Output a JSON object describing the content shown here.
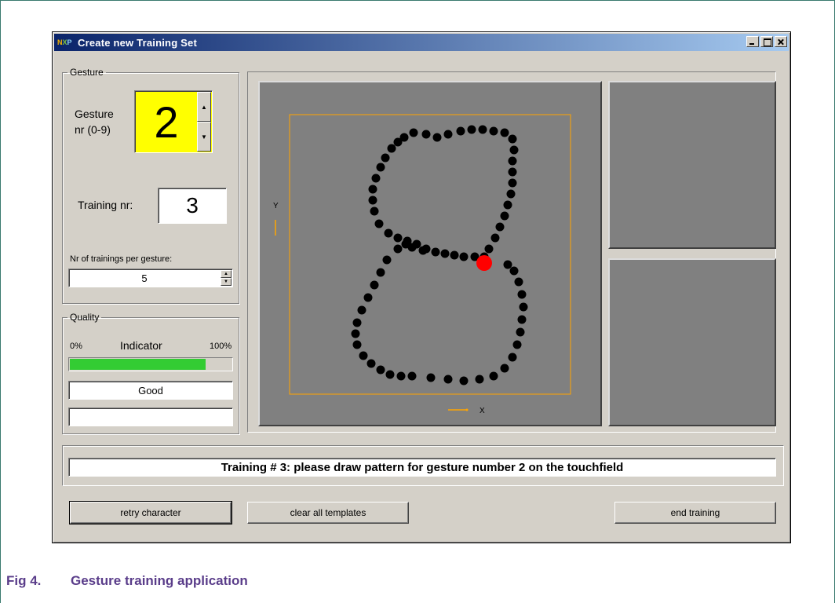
{
  "window": {
    "title": "Create new Training Set",
    "logo": {
      "n": "N",
      "x": "X",
      "p": "P"
    }
  },
  "gesture_group": {
    "legend": "Gesture",
    "gesture_label_line1": "Gesture",
    "gesture_label_line2": "nr (0-9)",
    "gesture_value": "2",
    "training_nr_label": "Training nr:",
    "training_nr_value": "3",
    "per_gesture_label": "Nr of trainings per gesture:",
    "per_gesture_value": "5"
  },
  "quality_group": {
    "legend": "Quality",
    "min_label": "0%",
    "indicator_label": "Indicator",
    "max_label": "100%",
    "indicator_fraction": 0.84,
    "quality_text": "Good",
    "secondary_text": ""
  },
  "touchfield": {
    "axis_y_label": "Y",
    "axis_x_label": "X",
    "pattern_digit": "8"
  },
  "status": {
    "message": "Training  # 3:  please draw pattern for gesture number 2 on the touchfield"
  },
  "buttons": {
    "retry": "retry character",
    "clear": "clear all templates",
    "end": "end training"
  },
  "caption": {
    "number": "Fig 4.",
    "text": "Gesture training application"
  },
  "colors": {
    "gesture_bg": "#ffff00",
    "progress": "#33cc33",
    "stroke_dot": "#000000",
    "current_dot": "#ff0000",
    "field_border": "#ffa500"
  }
}
